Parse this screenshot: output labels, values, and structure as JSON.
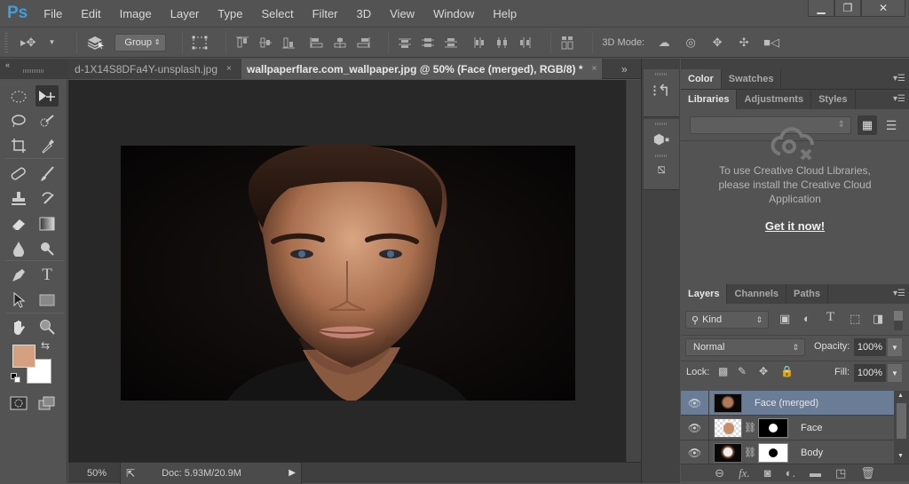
{
  "app": {
    "logo": "Ps"
  },
  "menu": [
    "File",
    "Edit",
    "Image",
    "Layer",
    "Type",
    "Select",
    "Filter",
    "3D",
    "View",
    "Window",
    "Help"
  ],
  "window_controls": {
    "minimize": "▁",
    "restore": "❐",
    "close": "✕"
  },
  "options_bar": {
    "auto_select_value": "Group",
    "mode_3d_label": "3D Mode:"
  },
  "tabs": [
    {
      "label": "d-1X14S8DFa4Y-unsplash.jpg",
      "close": "×",
      "active": false
    },
    {
      "label": "wallpaperflare.com_wallpaper.jpg @ 50% (Face (merged), RGB/8) *",
      "close": "×",
      "active": true
    }
  ],
  "tab_overflow": "»",
  "toolbox": {
    "collapse": "«",
    "foreground_color": "#d4a080",
    "background_color": "#ffffff"
  },
  "status": {
    "zoom": "50%",
    "doc": "Doc: 5.93M/20.9M",
    "arrow": "▶"
  },
  "panels": {
    "color_group": {
      "tabs": [
        "Color",
        "Swatches"
      ],
      "active": 0
    },
    "libraries_group": {
      "tabs": [
        "Libraries",
        "Adjustments",
        "Styles"
      ],
      "active": 0,
      "message": "To use Creative Cloud Libraries, please install the Creative Cloud Application",
      "message_lines": [
        "To use Creative Cloud Libraries,",
        "please install the Creative Cloud",
        "Application"
      ],
      "cta": "Get it now!",
      "swatch_color": "#a07a62"
    },
    "layers_group": {
      "tabs": [
        "Layers",
        "Channels",
        "Paths"
      ],
      "active": 0,
      "filter_kind": "Kind",
      "blend_mode": "Normal",
      "opacity_label": "Opacity:",
      "opacity": "100%",
      "lock_label": "Lock:",
      "fill_label": "Fill:",
      "fill": "100%",
      "layers": [
        {
          "name": "Face (merged)",
          "visible": true,
          "selected": true,
          "has_mask": false
        },
        {
          "name": "Face",
          "visible": true,
          "selected": false,
          "has_mask": true,
          "mask": "white circle on black"
        },
        {
          "name": "Body",
          "visible": true,
          "selected": false,
          "has_mask": true,
          "mask": "black circle on white"
        }
      ]
    }
  }
}
